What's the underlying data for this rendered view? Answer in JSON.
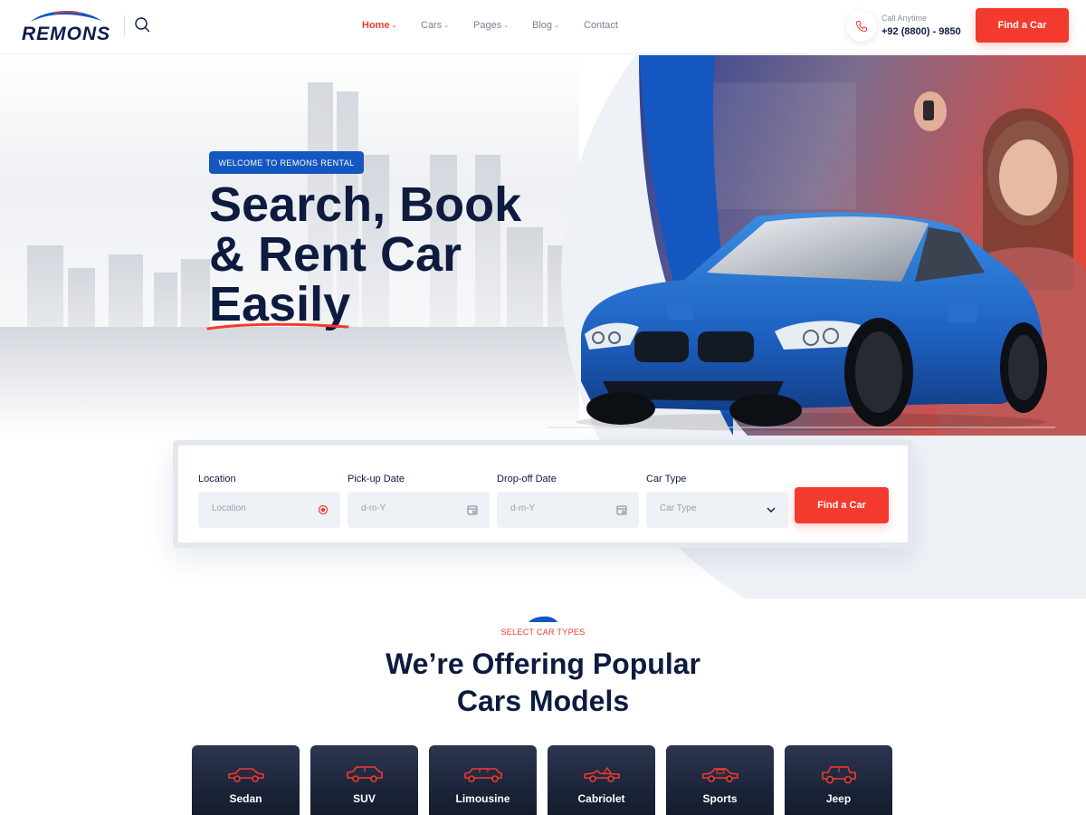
{
  "brand": {
    "name": "REMONS",
    "accent": "#f23a2e",
    "primary": "#0d1b3e",
    "blue": "#1557c0"
  },
  "header": {
    "nav": [
      {
        "label": "Home",
        "dropdown": true,
        "active": true
      },
      {
        "label": "Cars",
        "dropdown": true,
        "active": false
      },
      {
        "label": "Pages",
        "dropdown": true,
        "active": false
      },
      {
        "label": "Blog",
        "dropdown": true,
        "active": false
      },
      {
        "label": "Contact",
        "dropdown": false,
        "active": false
      }
    ],
    "call_label": "Call Anytime",
    "call_number": "+92 (8800) - 9850",
    "cta_label": "Find a Car"
  },
  "hero": {
    "badge": "WELCOME TO REMONS RENTAL",
    "title_lines": [
      "Search, Book",
      "& Rent Car",
      "Easily"
    ]
  },
  "booking": {
    "fields": [
      {
        "label": "Location",
        "placeholder": "Location",
        "icon": "location-pin-icon"
      },
      {
        "label": "Pick-up Date",
        "placeholder": "d-m-Y",
        "icon": "calendar-icon"
      },
      {
        "label": "Drop-off Date",
        "placeholder": "d-m-Y",
        "icon": "calendar-icon"
      },
      {
        "label": "Car Type",
        "placeholder": "Car Type",
        "icon": "chevron-down-icon"
      }
    ],
    "cta_label": "Find a Car"
  },
  "section": {
    "kicker": "SELECT CAR TYPES",
    "title_lines": [
      "We’re Offering Popular",
      "Cars Models"
    ]
  },
  "car_types": [
    {
      "label": "Sedan",
      "icon": "sedan-icon"
    },
    {
      "label": "SUV",
      "icon": "suv-icon"
    },
    {
      "label": "Limousine",
      "icon": "limousine-icon"
    },
    {
      "label": "Cabriolet",
      "icon": "cabriolet-icon"
    },
    {
      "label": "Sports",
      "icon": "sports-car-icon"
    },
    {
      "label": "Jeep",
      "icon": "jeep-icon"
    }
  ]
}
